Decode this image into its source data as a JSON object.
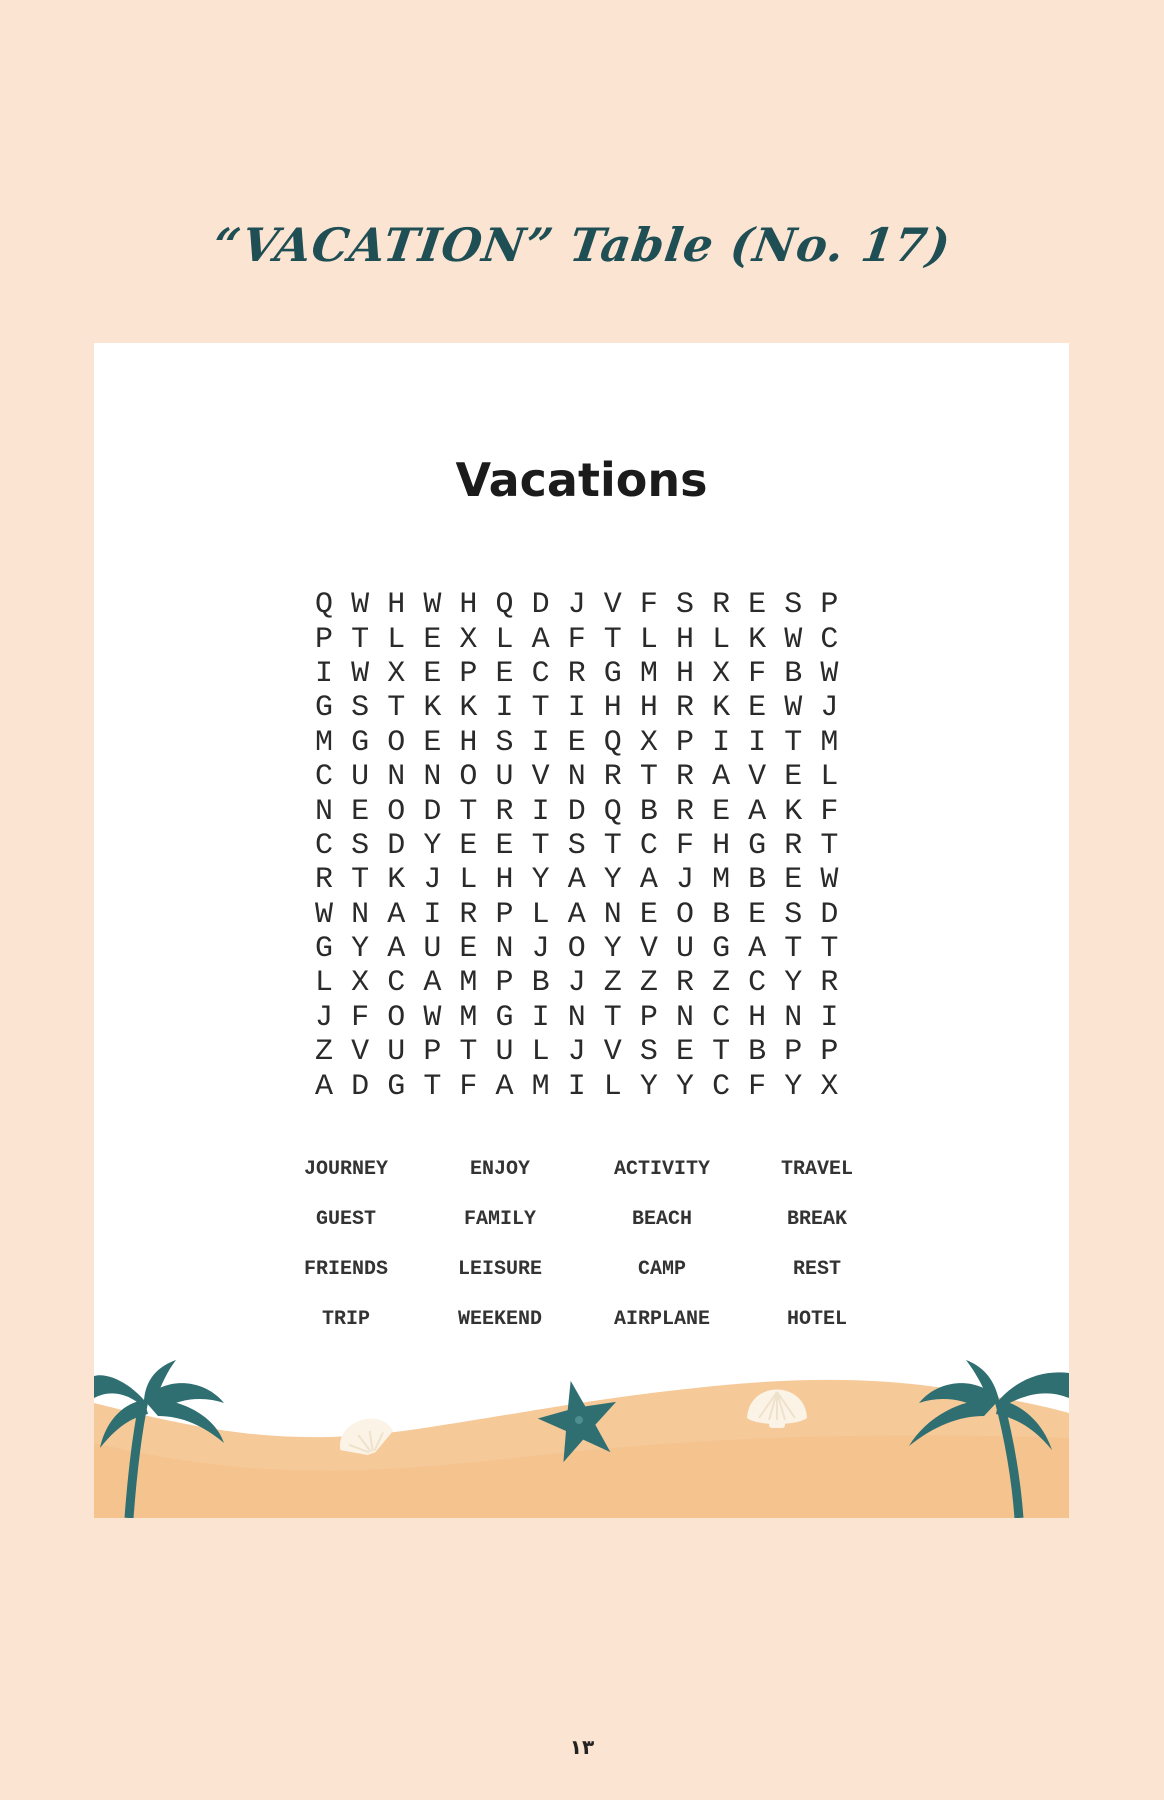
{
  "page": {
    "heading": "“VACATION” Table (No. 17)",
    "page_number": "١٣"
  },
  "puzzle": {
    "title": "Vacations",
    "grid": [
      [
        "Q",
        "W",
        "H",
        "W",
        "H",
        "Q",
        "D",
        "J",
        "V",
        "F",
        "S",
        "R",
        "E",
        "S",
        "P"
      ],
      [
        "P",
        "T",
        "L",
        "E",
        "X",
        "L",
        "A",
        "F",
        "T",
        "L",
        "H",
        "L",
        "K",
        "W",
        "C"
      ],
      [
        "I",
        "W",
        "X",
        "E",
        "P",
        "E",
        "C",
        "R",
        "G",
        "M",
        "H",
        "X",
        "F",
        "B",
        "W"
      ],
      [
        "G",
        "S",
        "T",
        "K",
        "K",
        "I",
        "T",
        "I",
        "H",
        "H",
        "R",
        "K",
        "E",
        "W",
        "J"
      ],
      [
        "M",
        "G",
        "O",
        "E",
        "H",
        "S",
        "I",
        "E",
        "Q",
        "X",
        "P",
        "I",
        "I",
        "T",
        "M"
      ],
      [
        "C",
        "U",
        "N",
        "N",
        "O",
        "U",
        "V",
        "N",
        "R",
        "T",
        "R",
        "A",
        "V",
        "E",
        "L"
      ],
      [
        "N",
        "E",
        "O",
        "D",
        "T",
        "R",
        "I",
        "D",
        "Q",
        "B",
        "R",
        "E",
        "A",
        "K",
        "F"
      ],
      [
        "C",
        "S",
        "D",
        "Y",
        "E",
        "E",
        "T",
        "S",
        "T",
        "C",
        "F",
        "H",
        "G",
        "R",
        "T"
      ],
      [
        "R",
        "T",
        "K",
        "J",
        "L",
        "H",
        "Y",
        "A",
        "Y",
        "A",
        "J",
        "M",
        "B",
        "E",
        "W"
      ],
      [
        "W",
        "N",
        "A",
        "I",
        "R",
        "P",
        "L",
        "A",
        "N",
        "E",
        "O",
        "B",
        "E",
        "S",
        "D"
      ],
      [
        "G",
        "Y",
        "A",
        "U",
        "E",
        "N",
        "J",
        "O",
        "Y",
        "V",
        "U",
        "G",
        "A",
        "T",
        "T"
      ],
      [
        "L",
        "X",
        "C",
        "A",
        "M",
        "P",
        "B",
        "J",
        "Z",
        "Z",
        "R",
        "Z",
        "C",
        "Y",
        "R"
      ],
      [
        "J",
        "F",
        "O",
        "W",
        "M",
        "G",
        "I",
        "N",
        "T",
        "P",
        "N",
        "C",
        "H",
        "N",
        "I"
      ],
      [
        "Z",
        "V",
        "U",
        "P",
        "T",
        "U",
        "L",
        "J",
        "V",
        "S",
        "E",
        "T",
        "B",
        "P",
        "P"
      ],
      [
        "A",
        "D",
        "G",
        "T",
        "F",
        "A",
        "M",
        "I",
        "L",
        "Y",
        "Y",
        "C",
        "F",
        "Y",
        "X"
      ]
    ],
    "words": [
      [
        "JOURNEY",
        "ENJOY",
        "ACTIVITY",
        "TRAVEL"
      ],
      [
        "GUEST",
        "FAMILY",
        "BEACH",
        "BREAK"
      ],
      [
        "FRIENDS",
        "LEISURE",
        "CAMP",
        "REST"
      ],
      [
        "TRIP",
        "WEEKEND",
        "AIRPLANE",
        "HOTEL"
      ]
    ]
  },
  "colors": {
    "page_background": "#fbe5d2",
    "heading": "#1f4f55",
    "sand": "#f6c998",
    "palm": "#2f6f72",
    "shell": "#fbf3e6"
  },
  "icons": [
    "palm-tree-icon",
    "starfish-icon",
    "seashell-icon"
  ]
}
